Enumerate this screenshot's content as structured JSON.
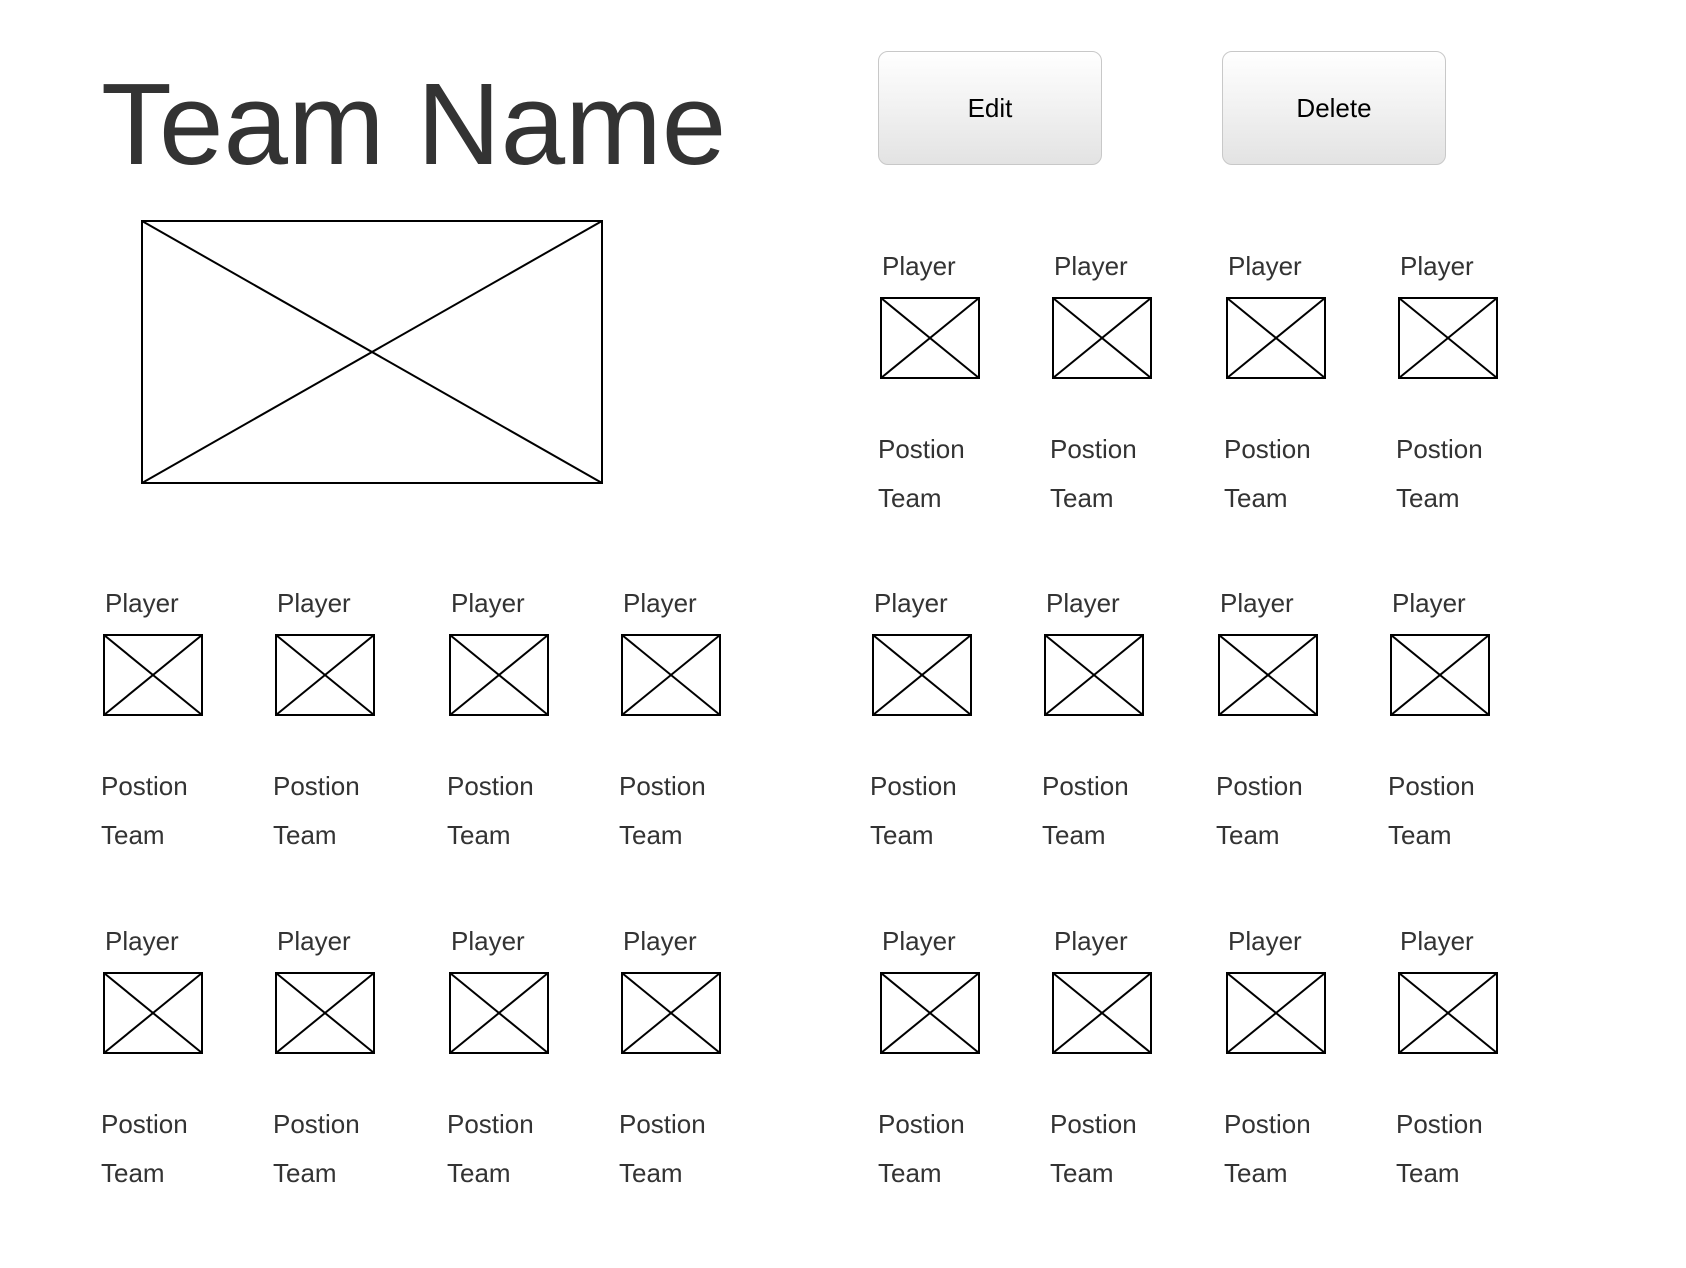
{
  "header": {
    "title": "Team Name",
    "logo_icon": "image-placeholder-icon"
  },
  "actions": {
    "edit_label": "Edit",
    "delete_label": "Delete"
  },
  "roster": {
    "groups": [
      {
        "players": [
          {
            "name": "Player",
            "position": "Postion",
            "team": "Team"
          },
          {
            "name": "Player",
            "position": "Postion",
            "team": "Team"
          },
          {
            "name": "Player",
            "position": "Postion",
            "team": "Team"
          },
          {
            "name": "Player",
            "position": "Postion",
            "team": "Team"
          }
        ]
      },
      {
        "players": [
          {
            "name": "Player",
            "position": "Postion",
            "team": "Team"
          },
          {
            "name": "Player",
            "position": "Postion",
            "team": "Team"
          },
          {
            "name": "Player",
            "position": "Postion",
            "team": "Team"
          },
          {
            "name": "Player",
            "position": "Postion",
            "team": "Team"
          }
        ]
      },
      {
        "players": [
          {
            "name": "Player",
            "position": "Postion",
            "team": "Team"
          },
          {
            "name": "Player",
            "position": "Postion",
            "team": "Team"
          },
          {
            "name": "Player",
            "position": "Postion",
            "team": "Team"
          },
          {
            "name": "Player",
            "position": "Postion",
            "team": "Team"
          }
        ]
      },
      {
        "players": [
          {
            "name": "Player",
            "position": "Postion",
            "team": "Team"
          },
          {
            "name": "Player",
            "position": "Postion",
            "team": "Team"
          },
          {
            "name": "Player",
            "position": "Postion",
            "team": "Team"
          },
          {
            "name": "Player",
            "position": "Postion",
            "team": "Team"
          }
        ]
      },
      {
        "players": [
          {
            "name": "Player",
            "position": "Postion",
            "team": "Team"
          },
          {
            "name": "Player",
            "position": "Postion",
            "team": "Team"
          },
          {
            "name": "Player",
            "position": "Postion",
            "team": "Team"
          },
          {
            "name": "Player",
            "position": "Postion",
            "team": "Team"
          }
        ]
      }
    ],
    "photo_icon": "image-placeholder-icon"
  }
}
